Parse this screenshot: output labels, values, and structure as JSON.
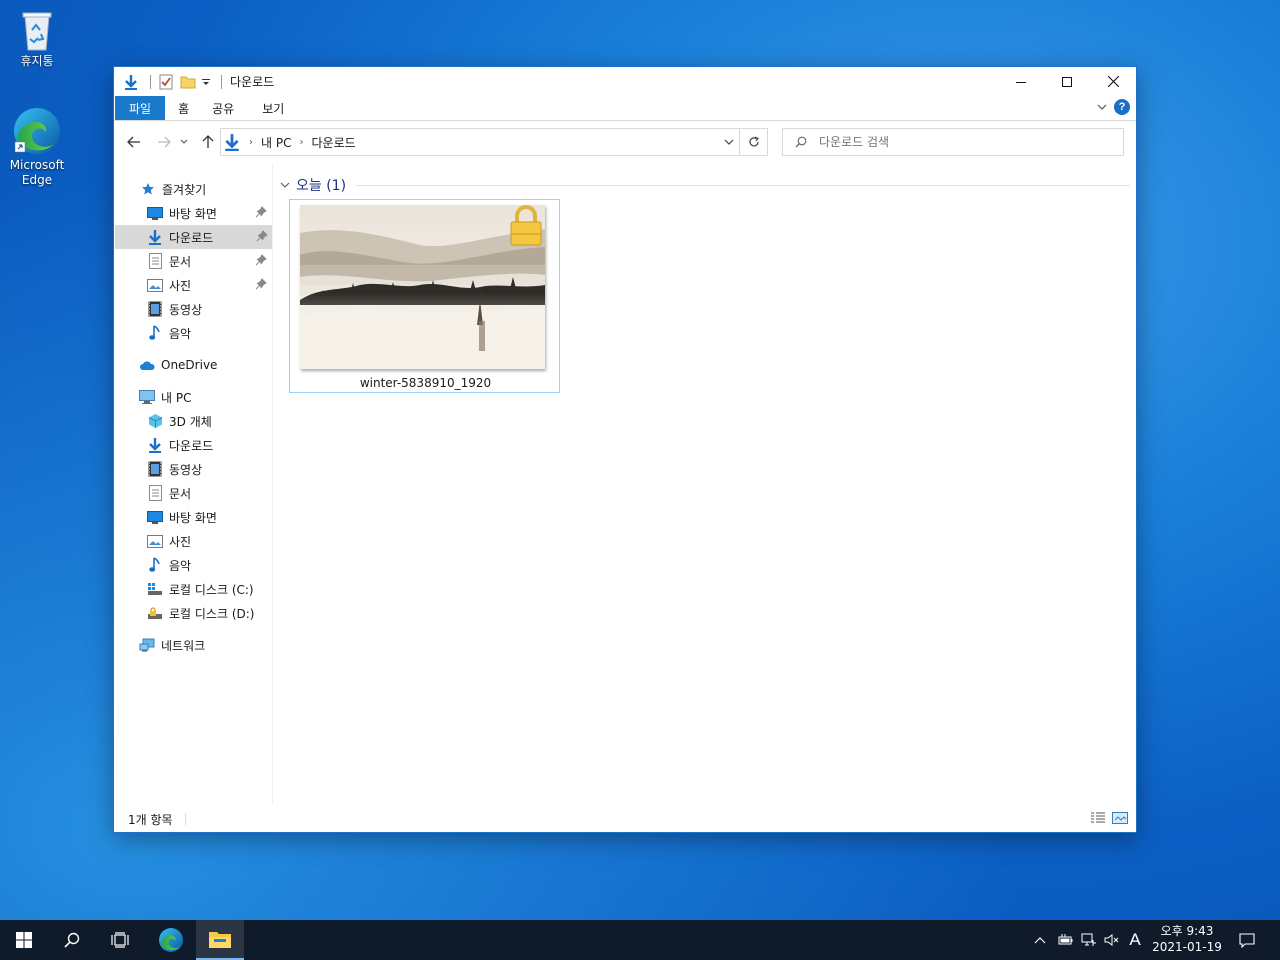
{
  "desktop": {
    "icons": [
      {
        "label": "휴지통"
      },
      {
        "label": "Microsoft Edge"
      }
    ]
  },
  "window": {
    "title": "다운로드",
    "ribbon_tabs": [
      "파일",
      "홈",
      "공유",
      "보기"
    ],
    "address": {
      "crumbs": [
        "내 PC",
        "다운로드"
      ]
    },
    "search": {
      "placeholder": "다운로드 검색"
    },
    "nav": {
      "quick_access": "즐겨찾기",
      "quick_items": [
        "바탕 화면",
        "다운로드",
        "문서",
        "사진",
        "동영상",
        "음악"
      ],
      "onedrive": "OneDrive",
      "this_pc": "내 PC",
      "pc_items": [
        "3D 개체",
        "다운로드",
        "동영상",
        "문서",
        "바탕 화면",
        "사진",
        "음악",
        "로컬 디스크 (C:)",
        "로컬 디스크 (D:)"
      ],
      "network": "네트워크"
    },
    "group": {
      "label": "오늘 (1)"
    },
    "files": [
      {
        "name": "winter-5838910_1920",
        "locked": true
      }
    ],
    "status": "1개 항목"
  },
  "taskbar": {
    "clock_time": "오후 9:43",
    "clock_date": "2021-01-19",
    "ime": "A"
  },
  "colors": {
    "accent": "#1979ca",
    "selected_nav": "#d9d9d9",
    "group_header": "#1e3287"
  }
}
